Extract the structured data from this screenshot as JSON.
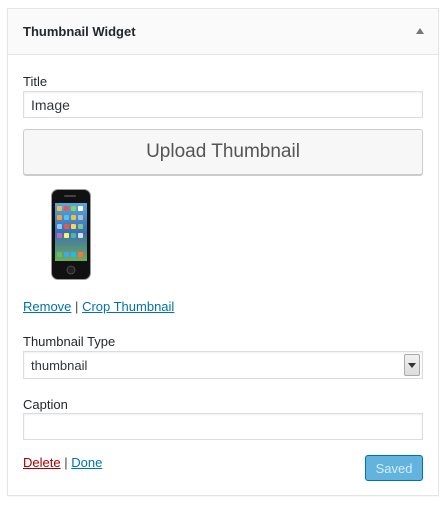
{
  "widget": {
    "title": "Thumbnail Widget",
    "toggle_icon": "caret-up-icon"
  },
  "form": {
    "title_label": "Title",
    "title_value": "Image",
    "upload_button": "Upload Thumbnail",
    "thumbnail_image": "iphone-image",
    "remove_link": "Remove",
    "crop_link": "Crop Thumbnail",
    "link_separator": "|",
    "type_label": "Thumbnail Type",
    "type_selected": "thumbnail",
    "caption_label": "Caption",
    "caption_value": ""
  },
  "actions": {
    "delete_link": "Delete",
    "done_link": "Done",
    "separator": "|",
    "saved_button": "Saved"
  }
}
